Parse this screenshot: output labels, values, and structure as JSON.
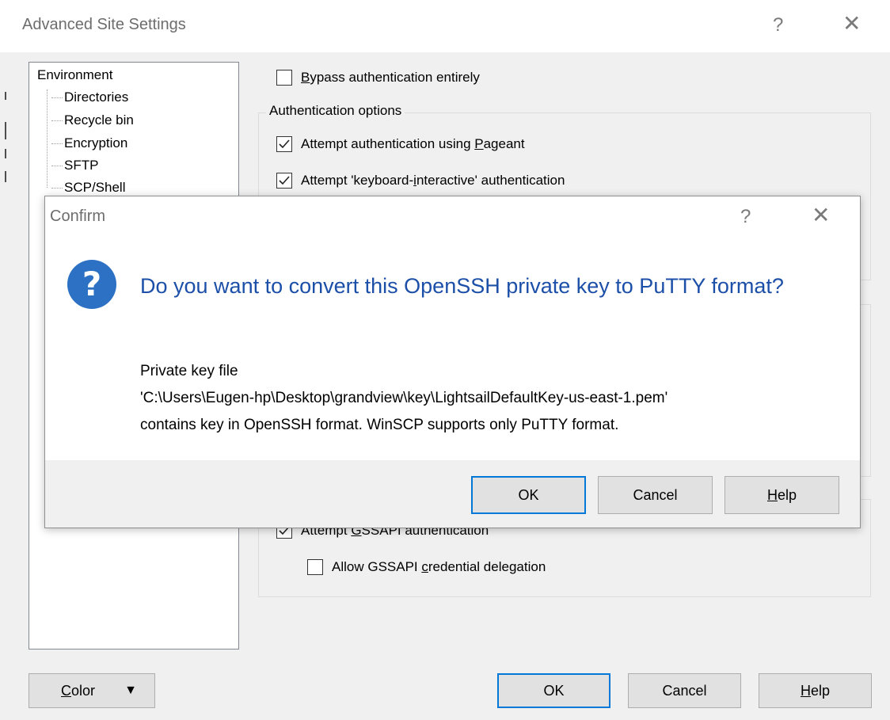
{
  "outer_window": {
    "title": "Advanced Site Settings",
    "help_glyph": "?",
    "close_glyph": "✕"
  },
  "tree": {
    "root": "Environment",
    "children": [
      "Directories",
      "Recycle bin",
      "Encryption",
      "SFTP",
      "SCP/Shell"
    ]
  },
  "auth": {
    "bypass": {
      "prefix": "",
      "accel": "B",
      "suffix": "ypass authentication entirely",
      "checked": false
    },
    "group_label": "Authentication options",
    "pageant": {
      "prefix": "Attempt authentication using ",
      "accel": "P",
      "suffix": "ageant",
      "checked": true
    },
    "kbd_interactive": {
      "prefix": "Attempt 'keyboard-",
      "accel": "i",
      "suffix": "nteractive' authentication",
      "checked": true
    },
    "gssapi": {
      "prefix": "Attempt ",
      "accel": "G",
      "suffix": "SSAPI authentication",
      "checked": true
    },
    "gssapi_delegation": {
      "prefix": "Allow GSSAPI ",
      "accel": "c",
      "suffix": "redential delegation",
      "checked": false
    }
  },
  "bottom_buttons": {
    "color_accel": "C",
    "color_rest": "olor",
    "color_arrow": "▼",
    "ok": "OK",
    "cancel": "Cancel",
    "help_accel": "H",
    "help_rest": "elp"
  },
  "confirm_dialog": {
    "title": "Confirm",
    "help_glyph": "?",
    "close_glyph": "✕",
    "icon_glyph": "?",
    "heading": "Do you want to convert this OpenSSH private key to PuTTY format?",
    "message_lines": [
      "Private key file",
      "'C:\\Users\\Eugen-hp\\Desktop\\grandview\\key\\LightsailDefaultKey-us-east-1.pem'",
      "contains key in OpenSSH format. WinSCP supports only PuTTY format."
    ],
    "ok": "OK",
    "cancel": "Cancel",
    "help_accel": "H",
    "help_rest": "elp"
  }
}
